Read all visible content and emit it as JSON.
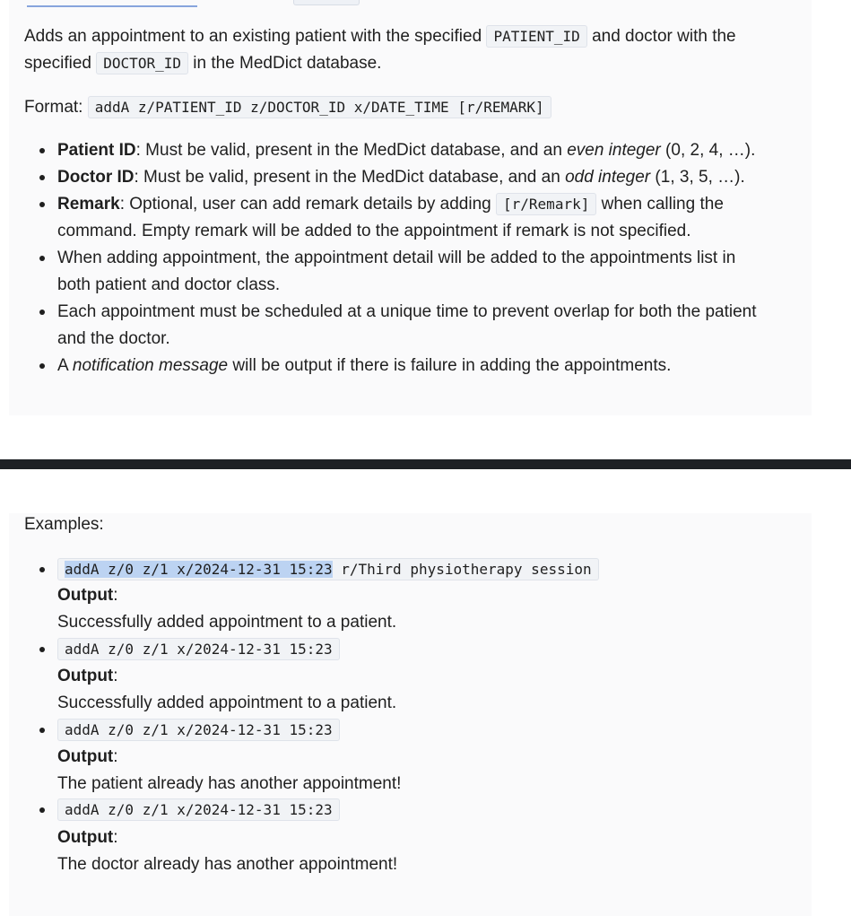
{
  "intro": {
    "p1_a": "Adds an appointment to an existing patient with the specified",
    "code_patient": "PATIENT_ID",
    "p1_b": "and doctor with the",
    "p1_c": "specified",
    "code_doctor": "DOCTOR_ID",
    "p1_d": "in the MedDict database."
  },
  "format": {
    "label": "Format:",
    "code": "addA z/PATIENT_ID z/DOCTOR_ID x/DATE_TIME [r/REMARK]"
  },
  "rules": {
    "patient_bold": "Patient ID",
    "patient_text": ": Must be valid, present in the MedDict database, and an",
    "patient_em": "even integer",
    "patient_tail": "(0, 2, 4, …).",
    "doctor_bold": "Doctor ID",
    "doctor_text": ": Must be valid, present in the MedDict database, and an",
    "doctor_em": "odd integer",
    "doctor_tail": "(1, 3, 5, …).",
    "remark_bold": "Remark",
    "remark_text": ": Optional, user can add remark details by adding",
    "remark_code": "[r/Remark]",
    "remark_tail": "when calling the",
    "remark_line2": "command. Empty remark will be added to the appointment if remark is not specified.",
    "add_line1": "When adding appointment, the appointment detail will be added to the appointments list in",
    "add_line2": "both patient and doctor class.",
    "unique_line1": "Each appointment must be scheduled at a unique time to prevent overlap for both the patient",
    "unique_line2": "and the doctor.",
    "notif_a": "A",
    "notif_em": "notification message",
    "notif_b": "will be output if there is failure in adding the appointments."
  },
  "examples": {
    "heading": "Examples:",
    "output_label": "Output",
    "colon": ":",
    "ex1_code_selected": "addA z/0 z/1 x/2024-12-31 15:23",
    "ex1_code_rest": " r/Third physiotherapy session",
    "ex1_output": "Successfully added appointment to a patient.",
    "ex2_code": "addA z/0 z/1 x/2024-12-31 15:23",
    "ex2_output": "Successfully added appointment to a patient.",
    "ex3_code": "addA z/0 z/1 x/2024-12-31 15:23",
    "ex3_output": "The patient already has another appointment!",
    "ex4_code": "addA z/0 z/1 x/2024-12-31 15:23",
    "ex4_output": "The doctor already has another appointment!"
  }
}
